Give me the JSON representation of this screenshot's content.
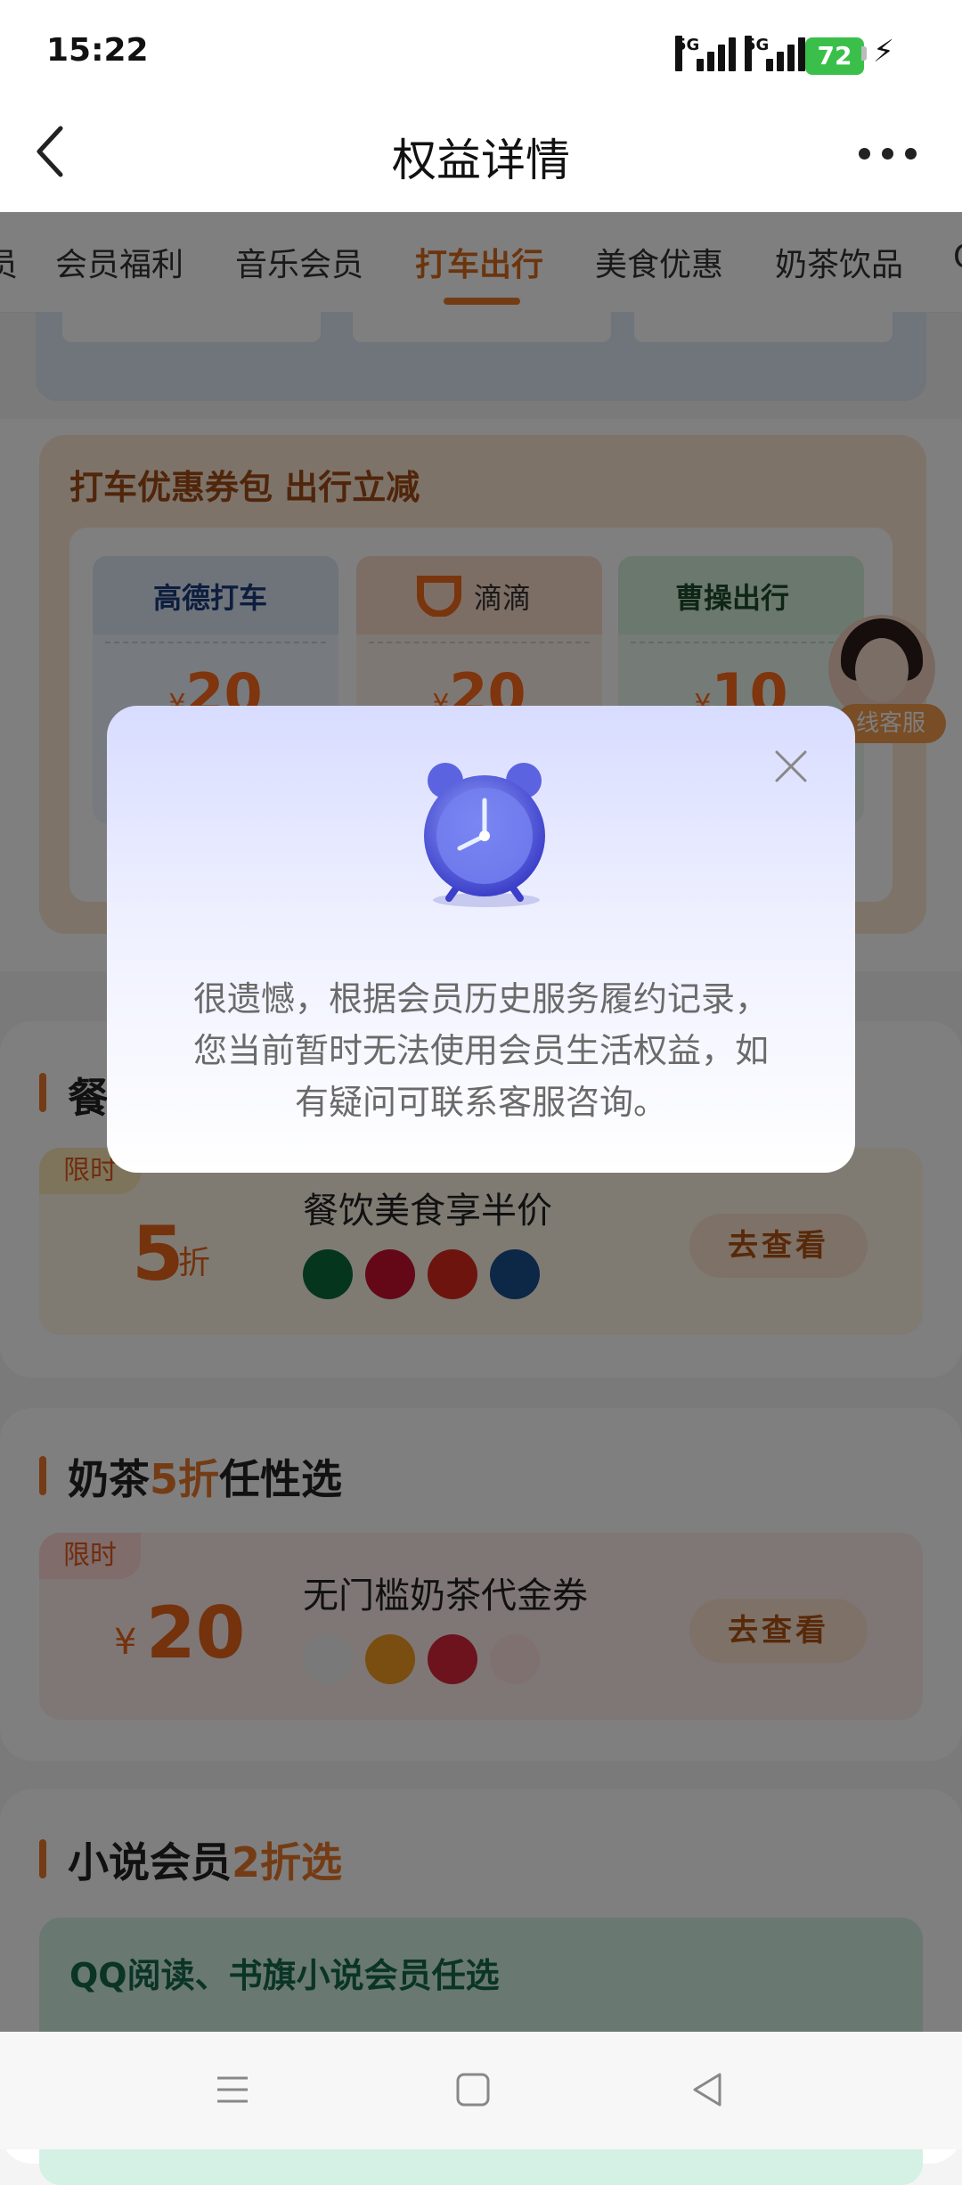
{
  "status": {
    "time": "15:22",
    "network1": "5G",
    "network2": "5G",
    "battery": "72"
  },
  "header": {
    "title": "权益详情"
  },
  "tabs": [
    "员",
    "会员福利",
    "音乐会员",
    "打车出行",
    "美食优惠",
    "奶茶饮品",
    "Q"
  ],
  "active_tab": "打车出行",
  "taxi": {
    "title": "打车优惠券包 出行立减",
    "coupons": [
      {
        "brand": "高德打车",
        "price": "20",
        "currency": "¥",
        "color": "#dfe9f7"
      },
      {
        "brand": "滴滴",
        "price": "20",
        "currency": "¥",
        "color": "#fbdccb"
      },
      {
        "brand": "曹操出行",
        "price": "10",
        "currency": "¥",
        "color": "#d7f0dd"
      }
    ]
  },
  "agent": {
    "label": "线客服"
  },
  "food": {
    "title_prefix": "餐",
    "limit": "限时",
    "discount": "5",
    "discount_unit": "折",
    "name": "餐饮美食享半价",
    "cta": "去查看"
  },
  "tea": {
    "title_a": "奶茶",
    "title_b": "5折",
    "title_c": "任性选",
    "limit": "限时",
    "currency": "¥",
    "amount": "20",
    "name": "无门槛奶茶代金券",
    "cta": "去查看"
  },
  "novel": {
    "title_a": "小说会员",
    "title_b": "2折选",
    "subtitle": "QQ阅读、书旗小说会员任选"
  },
  "modal": {
    "line1": "很遗憾，根据会员历史服务履约记录，",
    "line2": "您当前暂时无法使用会员生活权益，如",
    "line3": "有疑问可联系客服咨询。"
  }
}
